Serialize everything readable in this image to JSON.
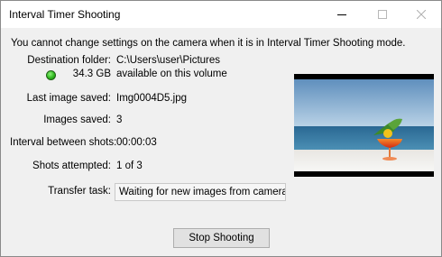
{
  "window": {
    "title": "Interval Timer Shooting"
  },
  "message": "You cannot change settings on the camera when it is in Interval Timer Shooting mode.",
  "fields": {
    "destination_label": "Destination folder:",
    "destination_value": "C:\\Users\\user\\Pictures",
    "free_space_value": "34.3 GB",
    "free_space_text": "available on this volume",
    "last_image_label": "Last image saved:",
    "last_image_value": "Img0004D5.jpg",
    "images_saved_label": "Images saved:",
    "images_saved_value": "3",
    "interval_label": "Interval between shots:",
    "interval_value": "00:00:03",
    "shots_label": "Shots attempted:",
    "shots_value": "1 of 3",
    "transfer_label": "Transfer task:",
    "transfer_value": "Waiting for new images from camera..."
  },
  "buttons": {
    "stop_label": "Stop Shooting"
  },
  "icons": {
    "status": "green-status-icon",
    "preview": "cocktail-beach-photo"
  },
  "colors": {
    "status_green": "#2fb81e",
    "dialog_bg": "#f0f0f0",
    "sky": "#8fb6d6",
    "sea": "#2d6f9a",
    "drink": "#e8401c"
  }
}
